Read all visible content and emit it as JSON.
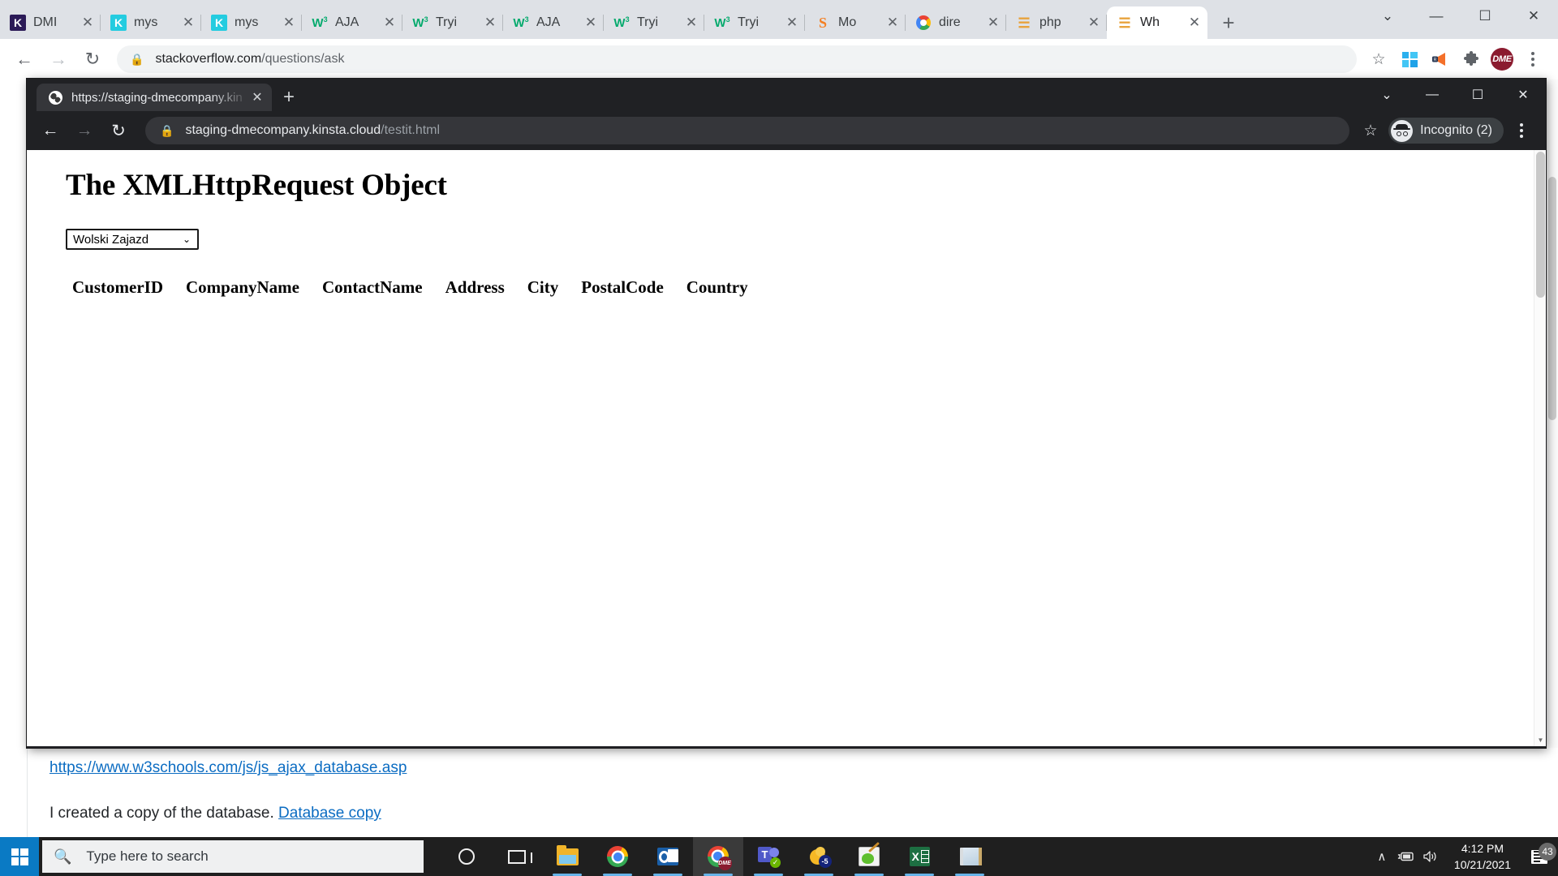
{
  "outer_browser": {
    "tabs": [
      {
        "title": "DMI",
        "favicon": "kinsta-dark-icon"
      },
      {
        "title": "mys",
        "favicon": "kinsta-cyan-icon"
      },
      {
        "title": "mys",
        "favicon": "kinsta-cyan-icon"
      },
      {
        "title": "AJA",
        "favicon": "w3schools-icon"
      },
      {
        "title": "Tryi",
        "favicon": "w3schools-icon"
      },
      {
        "title": "AJA",
        "favicon": "w3schools-icon"
      },
      {
        "title": "Tryi",
        "favicon": "w3schools-icon"
      },
      {
        "title": "Tryi",
        "favicon": "w3schools-icon"
      },
      {
        "title": "Mo",
        "favicon": "stackoverflow-icon"
      },
      {
        "title": "dire",
        "favicon": "google-icon"
      },
      {
        "title": "php",
        "favicon": "php-icon"
      },
      {
        "title": "Wh",
        "favicon": "php-icon",
        "active": true
      }
    ],
    "new_tab_label": "+",
    "close_label": "✕",
    "window_controls": {
      "list": "⌄",
      "minimize": "—",
      "maximize": "☐",
      "close": "✕"
    },
    "nav": {
      "back": "←",
      "forward": "→",
      "reload": "↻"
    },
    "address": {
      "lock_icon": "lock-icon",
      "host": "stackoverflow.com",
      "path": "/questions/ask"
    },
    "toolbar_icons": [
      {
        "name": "bookmark-star-icon",
        "glyph": "☆"
      },
      {
        "name": "windows-icon",
        "glyph": ""
      },
      {
        "name": "megaphone-icon",
        "glyph": "📣"
      },
      {
        "name": "extensions-puzzle-icon",
        "glyph": "🧩"
      },
      {
        "name": "profile-avatar",
        "glyph": "DME"
      },
      {
        "name": "chrome-menu-icon",
        "glyph": "⋮"
      }
    ]
  },
  "incognito_window": {
    "tab": {
      "title": "https://staging-dmecompany.kin",
      "favicon": "globe-icon",
      "close": "✕"
    },
    "new_tab_label": "+",
    "window_controls": {
      "list": "⌄",
      "minimize": "—",
      "maximize": "☐",
      "close": "✕"
    },
    "nav": {
      "back": "←",
      "forward": "→",
      "reload": "↻"
    },
    "address": {
      "lock_icon": "lock-icon",
      "host": "staging-dmecompany.kinsta.cloud",
      "path": "/testit.html"
    },
    "star_icon": "☆",
    "profile_pill": {
      "label": "Incognito (2)",
      "icon": "incognito-icon"
    },
    "menu_icon": "⋮"
  },
  "page": {
    "heading": "The XMLHttpRequest Object",
    "select": {
      "value": "Wolski Zajazd",
      "chevron": "⌄",
      "options": [
        "Wolski Zajazd"
      ]
    },
    "table": {
      "headers": [
        "CustomerID",
        "CompanyName",
        "ContactName",
        "Address",
        "City",
        "PostalCode",
        "Country"
      ],
      "rows": []
    }
  },
  "background_page": {
    "link_url": "https://www.w3schools.com/js/js_ajax_database.asp",
    "paragraph_text": "I created a copy of the database.",
    "paragraph_link": "Database copy"
  },
  "taskbar": {
    "start_icon": "windows-start-icon",
    "search": {
      "placeholder": "Type here to search",
      "icon": "search-icon"
    },
    "apps": [
      {
        "name": "cortana-icon",
        "label": "Cortana"
      },
      {
        "name": "task-view-icon",
        "label": "Task View"
      },
      {
        "name": "file-explorer-icon",
        "label": "File Explorer",
        "running": true
      },
      {
        "name": "chrome-icon",
        "label": "Google Chrome",
        "running": true
      },
      {
        "name": "outlook-icon",
        "label": "Outlook",
        "running": true
      },
      {
        "name": "chrome-dme-icon",
        "label": "Chrome DME",
        "running": true,
        "active": true
      },
      {
        "name": "teams-icon",
        "label": "Microsoft Teams",
        "running": true
      },
      {
        "name": "duck-icon",
        "label": "Duck -5",
        "running": true
      },
      {
        "name": "notepadpp-icon",
        "label": "Notepad++",
        "running": true
      },
      {
        "name": "excel-icon",
        "label": "Excel",
        "running": true
      },
      {
        "name": "notepad-icon",
        "label": "Notepad",
        "running": true
      }
    ],
    "tray": {
      "overflow_icon": "∧",
      "battery_icon": "battery-charging-icon",
      "volume_icon": "🔊",
      "time": "4:12 PM",
      "date": "10/21/2021",
      "notification_count": "43"
    }
  },
  "colors": {
    "chrome_tabstrip": "#dee1e6",
    "incognito_bg": "#202124",
    "link_blue": "#0b6cc2",
    "taskbar": "#1f1f1f",
    "start_blue": "#0a7ac4",
    "dme_red": "#8B1B2F"
  }
}
